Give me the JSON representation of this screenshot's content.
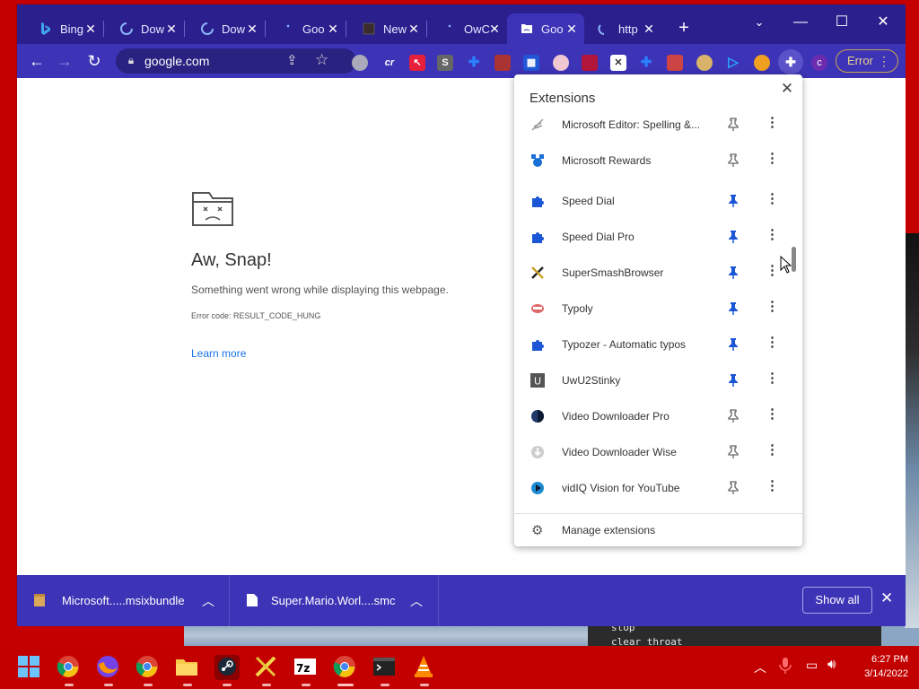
{
  "browser": {
    "tabs": [
      {
        "title": "Bing",
        "icon": "bing-icon",
        "active": false
      },
      {
        "title": "Dow",
        "icon": "loading-spinner-icon",
        "active": false
      },
      {
        "title": "Dow",
        "icon": "loading-spinner-icon",
        "active": false
      },
      {
        "title": "Goo",
        "icon": "loading-dot-icon",
        "active": false
      },
      {
        "title": "New",
        "icon": "new-tab-page-icon",
        "active": false
      },
      {
        "title": "OwC",
        "icon": "loading-dot-icon",
        "active": false
      },
      {
        "title": "Goo",
        "icon": "sad-tab-icon",
        "active": true
      },
      {
        "title": "http",
        "icon": "loading-spinner-icon",
        "active": false
      }
    ],
    "address": "google.com",
    "error_label": "Error",
    "extension_avatar": "c"
  },
  "page": {
    "title": "Aw, Snap!",
    "message": "Something went wrong while displaying this webpage.",
    "error_code": "Error code: RESULT_CODE_HUNG",
    "learn_more": "Learn more"
  },
  "extensions": {
    "title": "Extensions",
    "items": [
      {
        "name": "Microsoft Editor: Spelling &...",
        "pinned": false,
        "icon": "editor-quill-icon"
      },
      {
        "name": "Microsoft Rewards",
        "pinned": false,
        "icon": "rewards-medal-icon"
      },
      {
        "name": "Speed Dial",
        "pinned": true,
        "icon": "puzzle-icon"
      },
      {
        "name": "Speed Dial Pro",
        "pinned": true,
        "icon": "puzzle-icon"
      },
      {
        "name": "SuperSmashBrowser",
        "pinned": true,
        "icon": "crossed-swords-icon"
      },
      {
        "name": "Typoly",
        "pinned": true,
        "icon": "typoly-mouth-icon"
      },
      {
        "name": "Typozer - Automatic typos",
        "pinned": true,
        "icon": "puzzle-icon"
      },
      {
        "name": "UwU2Stinky",
        "pinned": true,
        "icon": "u-letter-icon"
      },
      {
        "name": "Video Downloader Pro",
        "pinned": false,
        "icon": "dark-circle-icon"
      },
      {
        "name": "Video Downloader Wise",
        "pinned": false,
        "icon": "download-arrow-icon"
      },
      {
        "name": "vidIQ Vision for YouTube",
        "pinned": false,
        "icon": "vidiq-play-icon"
      }
    ],
    "manage_label": "Manage extensions"
  },
  "downloads": {
    "items": [
      {
        "name": "Microsoft.....msixbundle",
        "icon": "package-icon"
      },
      {
        "name": "Super.Mario.Worl....smc",
        "icon": "file-icon"
      }
    ],
    "show_all": "Show all"
  },
  "desktop": {
    "terminal_lines": [
      "stop",
      "clear throat"
    ]
  },
  "taskbar": {
    "apps": [
      "windows-start-icon",
      "chrome-icon",
      "firefox-icon",
      "chrome-icon",
      "file-explorer-icon",
      "steam-icon",
      "sword-app-icon",
      "7zip-icon",
      "chrome-icon",
      "terminal-icon",
      "vlc-icon"
    ],
    "time": "6:27 PM",
    "date": "3/14/2022"
  },
  "colors": {
    "tab_bar": "#2b1f8e",
    "toolbar": "#3c33b6",
    "desktop": "#c50000",
    "pin_blue": "#1a56d6",
    "link_blue": "#1a73e8"
  }
}
